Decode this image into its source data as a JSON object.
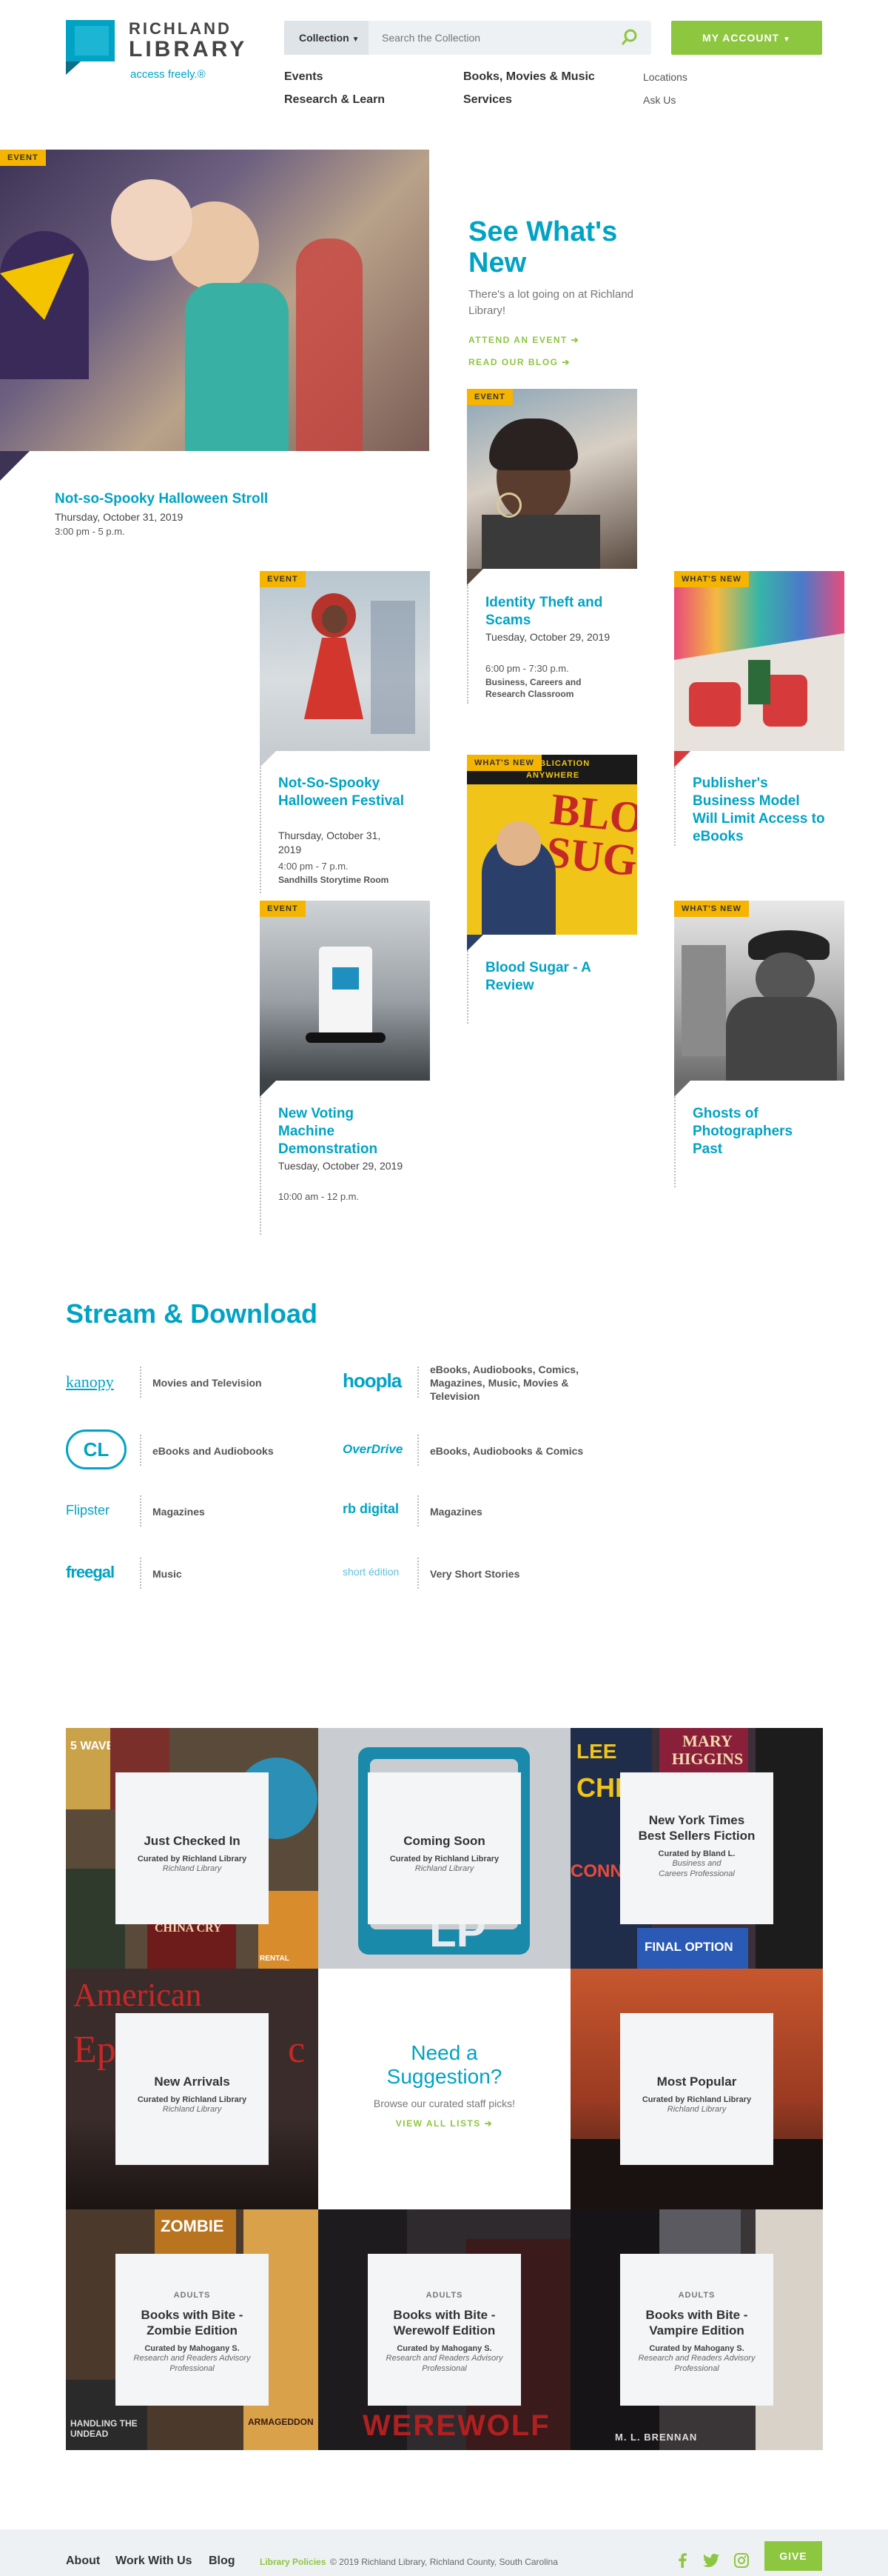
{
  "header": {
    "logo_line1": "RICHLAND",
    "logo_line2": "LIBRARY",
    "tagline": "access freely.®",
    "search_select": "Collection",
    "search_placeholder": "Search the Collection",
    "account_label": "MY ACCOUNT",
    "nav_primary": [
      "Events",
      "Books, Movies & Music",
      "Research & Learn",
      "Services"
    ],
    "nav_secondary": [
      "Locations",
      "Ask Us"
    ]
  },
  "whats_new": {
    "title_line1": "See What's",
    "title_line2": "New",
    "intro": "There's a lot going on at Richland Library!",
    "cta_event": "ATTEND AN EVENT ➔",
    "cta_blog": "READ OUR BLOG ➔"
  },
  "cards": [
    {
      "tag": "EVENT",
      "title": "Not-so-Spooky Halloween Stroll",
      "date": "Thursday, October 31, 2019",
      "time": "3:00 pm - 5 p.m.",
      "location": ""
    },
    {
      "tag": "EVENT",
      "title": "Identity Theft and Scams",
      "date": "Tuesday, October 29, 2019",
      "time": "6:00 pm - 7:30 p.m.",
      "location": "Business, Careers and Research Classroom"
    },
    {
      "tag": "EVENT",
      "title": "Not-So-Spooky Halloween Festival",
      "date": "Thursday, October 31, 2019",
      "time": "4:00 pm - 7 p.m.",
      "location": "Sandhills Storytime Room"
    },
    {
      "tag": "WHAT'S NEW",
      "title": "Publisher's Business Model Will Limit Access to eBooks",
      "date": "",
      "time": "",
      "location": ""
    },
    {
      "tag": "WHAT'S NEW",
      "title": "Blood Sugar - A Review",
      "date": "",
      "time": "",
      "location": "",
      "cover_text_1": "FIRST PUBLICATION",
      "cover_text_2": "ANYWHERE",
      "cover_big": "BLOOD SUG"
    },
    {
      "tag": "EVENT",
      "title": "New Voting Machine Demonstration",
      "date": "Tuesday, October 29, 2019",
      "time": "10:00 am - 12 p.m.",
      "location": ""
    },
    {
      "tag": "WHAT'S NEW",
      "title": "Ghosts of Photographers Past",
      "date": "",
      "time": "",
      "location": ""
    }
  ],
  "stream": {
    "title": "Stream & Download",
    "items": [
      {
        "logo": "kanopy",
        "label": "Movies and Television"
      },
      {
        "logo": "hoopla",
        "label": "eBooks, Audiobooks, Comics, Magazines, Music, Movies & Television"
      },
      {
        "logo": "CL",
        "label": "eBooks and Audiobooks"
      },
      {
        "logo": "OverDrive",
        "label": "eBooks, Audiobooks & Comics"
      },
      {
        "logo": "Flipster",
        "label": "Magazines"
      },
      {
        "logo": "rb digital",
        "label": "Magazines"
      },
      {
        "logo": "freegal",
        "label": "Music"
      },
      {
        "logo": "short édition",
        "label": "Very Short Stories"
      }
    ]
  },
  "lists": [
    {
      "category": "",
      "title": "Just Checked In",
      "curator": "Curated by Richland Library",
      "role": "Richland Library",
      "bg": "#5a4a3a"
    },
    {
      "category": "",
      "title": "Coming Soon",
      "curator": "Curated by Richland Library",
      "role": "Richland Library",
      "bg": "#c9cdd1"
    },
    {
      "category": "",
      "title": "New York Times Best Sellers Fiction",
      "curator": "Curated by Bland L.",
      "role": "Business and Careers Professional",
      "bg": "#3b2f3a"
    },
    {
      "category": "",
      "title": "New Arrivals",
      "curator": "Curated by Richland Library",
      "role": "Richland Library",
      "bg": "#4a3a33"
    },
    {
      "category": "",
      "title": "Most Popular",
      "curator": "Curated by Richland Library",
      "role": "Richland Library",
      "bg": "#a04a2c"
    },
    {
      "category": "ADULTS",
      "title": "Books with Bite - Zombie Edition",
      "curator": "Curated by Mahogany S.",
      "role": "Research and Readers Advisory Professional",
      "bg": "#4b3a2b"
    },
    {
      "category": "ADULTS",
      "title": "Books with Bite - Werewolf Edition",
      "curator": "Curated by Mahogany S.",
      "role": "Research and Readers Advisory Professional",
      "bg": "#2e2a2d"
    },
    {
      "category": "ADULTS",
      "title": "Books with Bite - Vampire Edition",
      "curator": "Curated by Mahogany S.",
      "role": "Research and Readers Advisory Professional",
      "bg": "#3a3536"
    }
  ],
  "suggestion": {
    "title_line1": "Need a",
    "title_line2": "Suggestion?",
    "text": "Browse our curated staff picks!",
    "cta": "VIEW ALL LISTS ➔"
  },
  "tile_art": {
    "american": "American",
    "epic": "Ep",
    "c": "c",
    "china": "CHINA CRY",
    "wave": "5 WAVE",
    "rental": "RENTAL",
    "mary": "MARY HIGGINS",
    "child": "CHILD",
    "lee": "LEE",
    "connelly": "CONNELLY",
    "final": "FINAL OPTION",
    "zombie": "ZOMBIE",
    "handling": "HANDLING THE UNDEAD",
    "armageddon": "ARMAGEDDON",
    "werewolf": "WEREWOLF",
    "brennan": "M. L. BRENNAN",
    "lp": "LP"
  },
  "footer": {
    "links": [
      "About",
      "Work With Us",
      "Blog"
    ],
    "policies": "Library Policies",
    "copyright": "© 2019 Richland Library, Richland County, South Carolina",
    "give": "GIVE"
  },
  "colors": {
    "teal": "#00a3c4",
    "green": "#8dc63f",
    "yellow": "#f5b400"
  }
}
